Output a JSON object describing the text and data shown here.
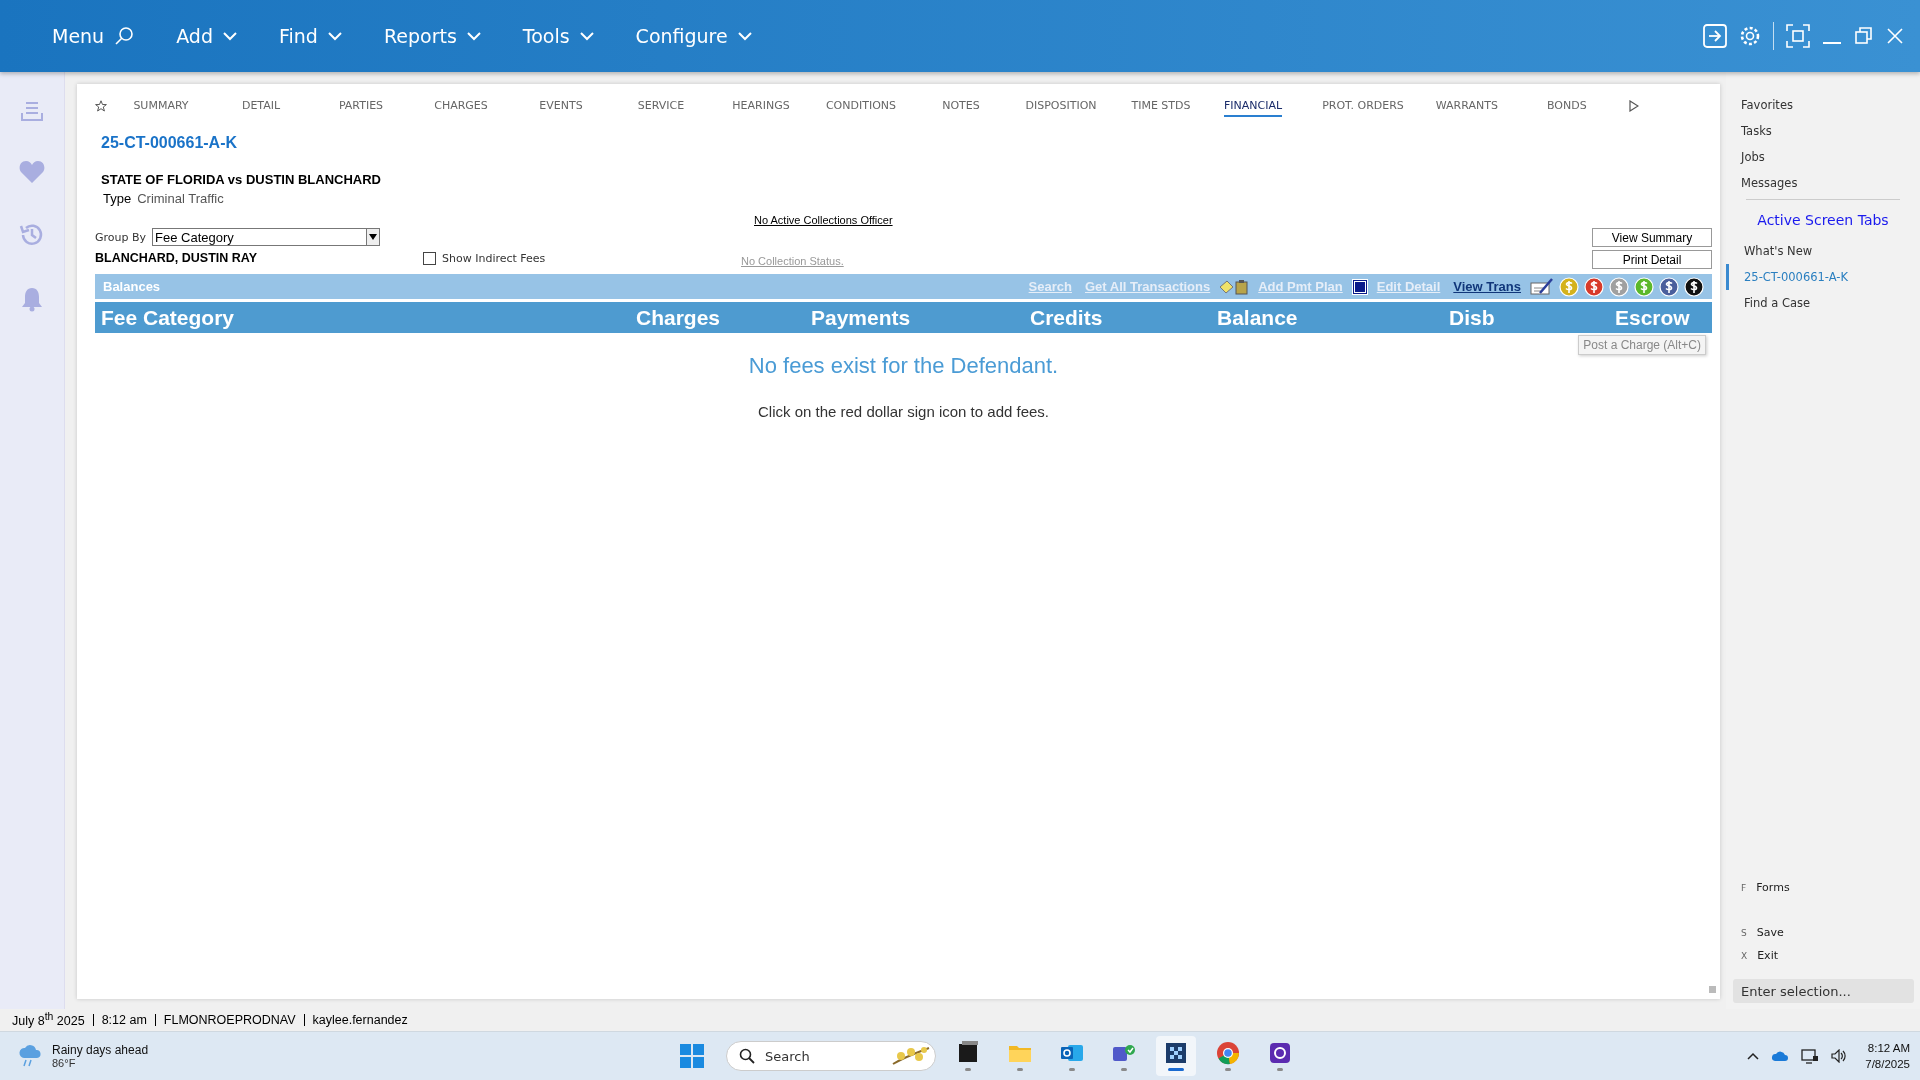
{
  "menu_bar": {
    "items": [
      {
        "label": "Menu",
        "kind": "search"
      },
      {
        "label": "Add",
        "kind": "dropdown"
      },
      {
        "label": "Find",
        "kind": "dropdown"
      },
      {
        "label": "Reports",
        "kind": "dropdown"
      },
      {
        "label": "Tools",
        "kind": "dropdown"
      },
      {
        "label": "Configure",
        "kind": "dropdown"
      }
    ]
  },
  "tabs": [
    {
      "label": "SUMMARY",
      "selected": false
    },
    {
      "label": "DETAIL",
      "selected": false
    },
    {
      "label": "PARTIES",
      "selected": false
    },
    {
      "label": "CHARGES",
      "selected": false
    },
    {
      "label": "EVENTS",
      "selected": false
    },
    {
      "label": "SERVICE",
      "selected": false
    },
    {
      "label": "HEARINGS",
      "selected": false
    },
    {
      "label": "CONDITIONS",
      "selected": false
    },
    {
      "label": "NOTES",
      "selected": false
    },
    {
      "label": "DISPOSITION",
      "selected": false
    },
    {
      "label": "TIME STDS",
      "selected": false
    },
    {
      "label": "FINANCIAL",
      "selected": true
    },
    {
      "label": "PROT. ORDERS",
      "selected": false
    },
    {
      "label": "WARRANTS",
      "selected": false
    },
    {
      "label": "BONDS",
      "selected": false
    }
  ],
  "case": {
    "number": "25-CT-000661-A-K",
    "title": "STATE OF FLORIDA vs DUSTIN BLANCHARD",
    "type_label": "Type",
    "type_value": "Criminal Traffic"
  },
  "collections_officer": "No Active Collections Officer",
  "group_by": {
    "label": "Group By",
    "value": "Fee Category"
  },
  "defendant_name": "BLANCHARD, DUSTIN RAY",
  "show_indirect_fees": {
    "label": "Show Indirect Fees",
    "checked": false
  },
  "collection_status": "No Collection Status.",
  "buttons": [
    "View Summary",
    "Print Detail"
  ],
  "balances": {
    "title": "Balances",
    "toolbar": [
      {
        "kind": "link",
        "label": "Search",
        "disabled": true
      },
      {
        "kind": "link",
        "label": "Get All Transactions",
        "disabled": true
      },
      {
        "kind": "notes"
      },
      {
        "kind": "link",
        "label": "Add Pmt Plan",
        "disabled": true
      },
      {
        "kind": "word"
      },
      {
        "kind": "link",
        "label": "Edit Detail",
        "disabled": true
      },
      {
        "kind": "link",
        "label": "View Trans",
        "disabled": false
      },
      {
        "kind": "check"
      },
      {
        "kind": "coin",
        "color": "#d4b21c"
      },
      {
        "kind": "coin",
        "color": "#d83a2a"
      },
      {
        "kind": "coin",
        "color": "#a0a0a0"
      },
      {
        "kind": "coin",
        "color": "#5cb82a"
      },
      {
        "kind": "coin",
        "color": "#4a5e9c"
      },
      {
        "kind": "coin",
        "color": "#111111"
      }
    ]
  },
  "table": {
    "columns": [
      "Fee Category",
      "Charges",
      "Payments",
      "Credits",
      "Balance",
      "Disb",
      "Escrow"
    ],
    "empty_message": "No fees exist for the Defendant.",
    "hint": "Click on the red dollar sign icon to add fees."
  },
  "tooltip": "Post a Charge (Alt+C)",
  "right_panel": {
    "links": [
      "Favorites",
      "Tasks",
      "Jobs",
      "Messages"
    ],
    "section_title": "Active Screen Tabs",
    "screen_tabs": [
      {
        "label": "What's New",
        "selected": false
      },
      {
        "label": "25-CT-000661-A-K",
        "selected": true
      },
      {
        "label": "Find a Case",
        "selected": false
      }
    ],
    "shortcuts": [
      {
        "key": "F",
        "label": "Forms"
      },
      {
        "key": "S",
        "label": "Save"
      },
      {
        "key": "X",
        "label": "Exit"
      }
    ],
    "input_placeholder": "Enter selection..."
  },
  "status_bar": {
    "date": "July 8$^{th}$ 2025",
    "time": "8:12 am",
    "server": "FLMONROEPRODNAV",
    "user": "kaylee.fernandez"
  },
  "taskbar": {
    "weather_title": "Rainy days ahead",
    "weather_temp": "86°F",
    "search_placeholder": "Search",
    "apps": [
      {
        "kind": "window",
        "selected": false
      },
      {
        "kind": "folder",
        "selected": false
      },
      {
        "kind": "mail",
        "selected": false
      },
      {
        "kind": "chat",
        "selected": false
      },
      {
        "kind": "grid",
        "selected": true
      },
      {
        "kind": "browser",
        "selected": false
      },
      {
        "kind": "camera",
        "selected": false
      }
    ],
    "clock_time": "8:12 AM",
    "clock_date": "7/8/2025"
  }
}
